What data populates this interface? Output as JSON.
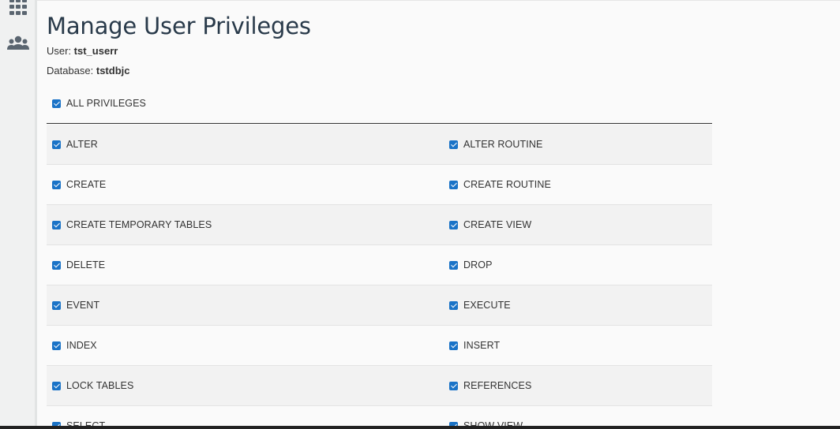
{
  "sidebar": {
    "icons": [
      "apps-grid-icon",
      "users-group-icon"
    ]
  },
  "page": {
    "title": "Manage User Privileges",
    "user_label": "User: ",
    "user_value": "tst_userr",
    "db_label": "Database: ",
    "db_value": "tstdbjc"
  },
  "all_privileges": {
    "label": "ALL PRIVILEGES",
    "checked": true
  },
  "privileges": [
    {
      "left": "ALTER",
      "right": "ALTER ROUTINE"
    },
    {
      "left": "CREATE",
      "right": "CREATE ROUTINE"
    },
    {
      "left": "CREATE TEMPORARY TABLES",
      "right": "CREATE VIEW"
    },
    {
      "left": "DELETE",
      "right": "DROP"
    },
    {
      "left": "EVENT",
      "right": "EXECUTE"
    },
    {
      "left": "INDEX",
      "right": "INSERT"
    },
    {
      "left": "LOCK TABLES",
      "right": "REFERENCES"
    },
    {
      "left": "SELECT",
      "right": "SHOW VIEW"
    }
  ],
  "colors": {
    "checkbox": "#1a73c7",
    "title": "#293a4a"
  }
}
